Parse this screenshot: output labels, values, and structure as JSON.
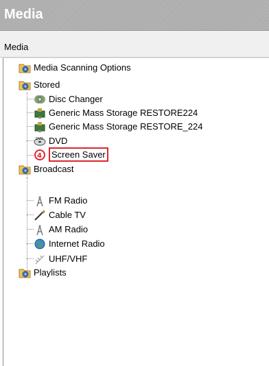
{
  "window": {
    "title": "Media"
  },
  "toolbar": {
    "label": "Media"
  },
  "tree": {
    "root_items": [
      {
        "label": "Media Scanning Options",
        "icon": "folder-disc-icon"
      },
      {
        "label": "Stored",
        "icon": "folder-disc-icon"
      }
    ],
    "stored_children": [
      {
        "label": "Disc Changer",
        "icon": "disc-changer-icon"
      },
      {
        "label": "Generic Mass Storage RESTORE224",
        "icon": "usb-storage-icon"
      },
      {
        "label": "Generic Mass Storage RESTORE_224",
        "icon": "usb-storage-icon"
      },
      {
        "label": "DVD",
        "icon": "dvd-icon"
      },
      {
        "label": "Screen Saver",
        "icon": "screen-saver-icon",
        "selected": true
      }
    ],
    "broadcast": {
      "label": "Broadcast",
      "icon": "folder-disc-icon"
    },
    "broadcast_children": [
      {
        "label": "FM Radio",
        "icon": "radio-tower-icon"
      },
      {
        "label": "Cable TV",
        "icon": "cable-icon"
      },
      {
        "label": "AM Radio",
        "icon": "radio-tower-icon"
      },
      {
        "label": "Internet Radio",
        "icon": "globe-icon"
      },
      {
        "label": "UHF/VHF",
        "icon": "antenna-icon"
      }
    ],
    "playlists": {
      "label": "Playlists",
      "icon": "folder-disc-icon"
    }
  },
  "colors": {
    "selection_border": "#e0242c",
    "titlebar": "#b0b0b0"
  }
}
